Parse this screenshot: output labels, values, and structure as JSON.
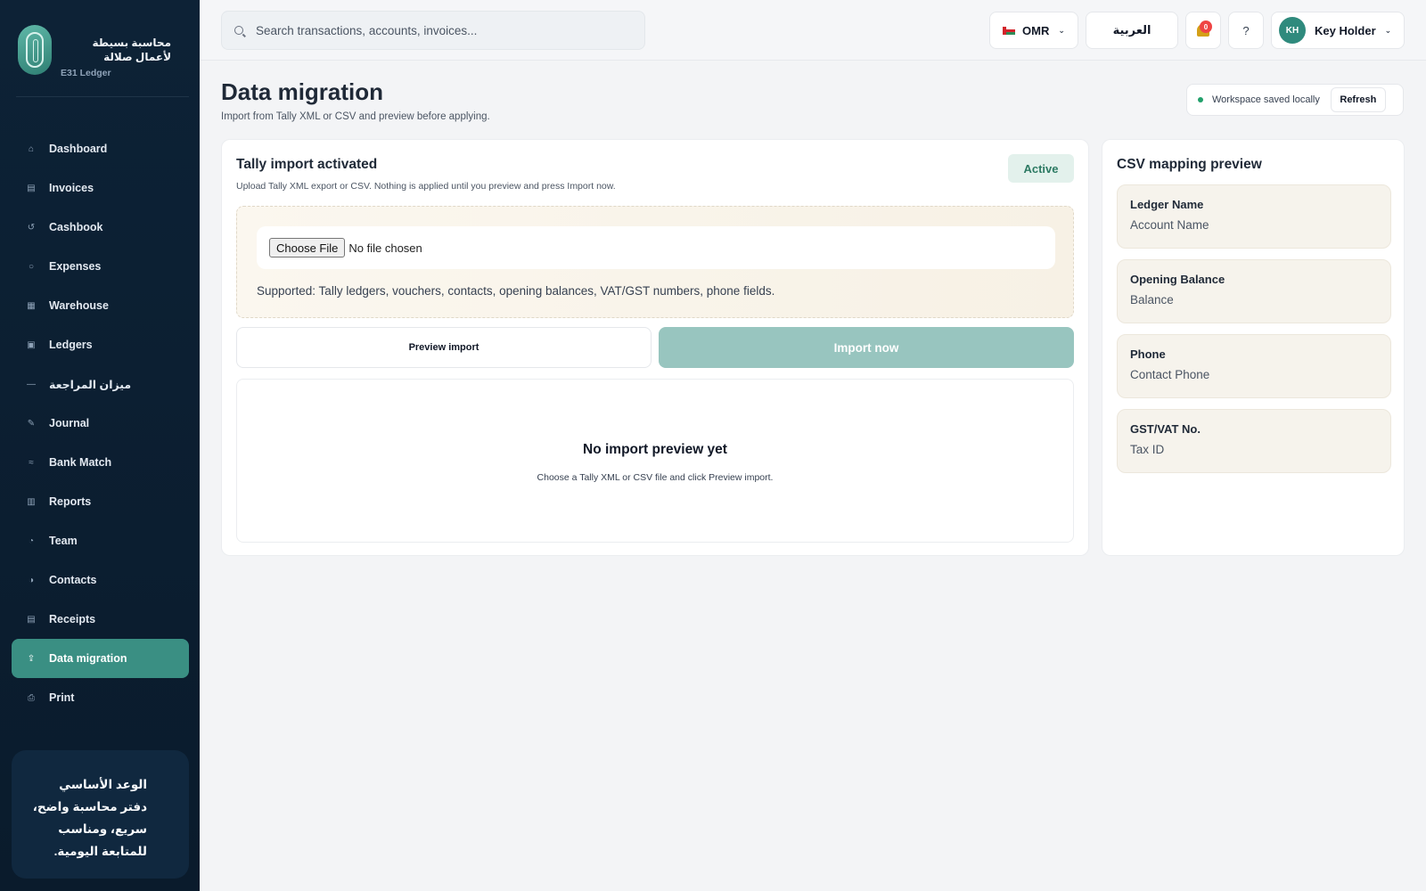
{
  "brand": {
    "name": "محاسبة بسيطة لأعمال صلالة",
    "subtitle": "E31 Ledger"
  },
  "sidebar": {
    "items": [
      {
        "label": "Dashboard",
        "icon": "⌂"
      },
      {
        "label": "Invoices",
        "icon": "▤"
      },
      {
        "label": "Cashbook",
        "icon": "↺"
      },
      {
        "label": "Expenses",
        "icon": "○"
      },
      {
        "label": "Warehouse",
        "icon": "▦"
      },
      {
        "label": "Ledgers",
        "icon": "▣"
      },
      {
        "label": "ميزان المراجعة",
        "icon": "—"
      },
      {
        "label": "Journal",
        "icon": "✎"
      },
      {
        "label": "Bank Match",
        "icon": "≈"
      },
      {
        "label": "Reports",
        "icon": "▥"
      },
      {
        "label": "Team",
        "icon": "◔"
      },
      {
        "label": "Contacts",
        "icon": "◑"
      },
      {
        "label": "Receipts",
        "icon": "▤"
      },
      {
        "label": "Data migration",
        "icon": "⇪",
        "active": true
      },
      {
        "label": "Print",
        "icon": "⎙"
      }
    ],
    "promo": "الوعد الأساسي دفتر محاسبة واضح، سريع، ومناسب للمتابعة اليومية."
  },
  "topbar": {
    "search_placeholder": "Search transactions, accounts, invoices...",
    "currency": "OMR",
    "language": "العربية",
    "notifications_count": "0",
    "help": "?",
    "user_initials": "KH",
    "user_name": "Key Holder"
  },
  "header": {
    "title": "Data migration",
    "subtitle": "Import from Tally XML or CSV and preview before applying.",
    "status": "Workspace saved locally",
    "refresh_label": "Refresh"
  },
  "import_card": {
    "title": "Tally import activated",
    "subtitle": "Upload Tally XML export or CSV. Nothing is applied until you preview and press Import now.",
    "badge": "Active",
    "file_button": "Choose File",
    "file_status": "No file chosen",
    "supported": "Supported: Tally ledgers, vouchers, contacts, opening balances, VAT/GST numbers, phone fields.",
    "preview_button": "Preview import",
    "import_button": "Import now",
    "empty_title": "No import preview yet",
    "empty_subtitle": "Choose a Tally XML or CSV file and click Preview import."
  },
  "mapping": {
    "title": "CSV mapping preview",
    "items": [
      {
        "source": "Ledger Name",
        "target": "Account Name"
      },
      {
        "source": "Opening Balance",
        "target": "Balance"
      },
      {
        "source": "Phone",
        "target": "Contact Phone"
      },
      {
        "source": "GST/VAT No.",
        "target": "Tax ID"
      }
    ]
  },
  "colors": {
    "sidebar_bg": "#0d2236",
    "accent": "#3a8f83",
    "import_button": "#98c5bf",
    "status_green": "#22a06b"
  }
}
